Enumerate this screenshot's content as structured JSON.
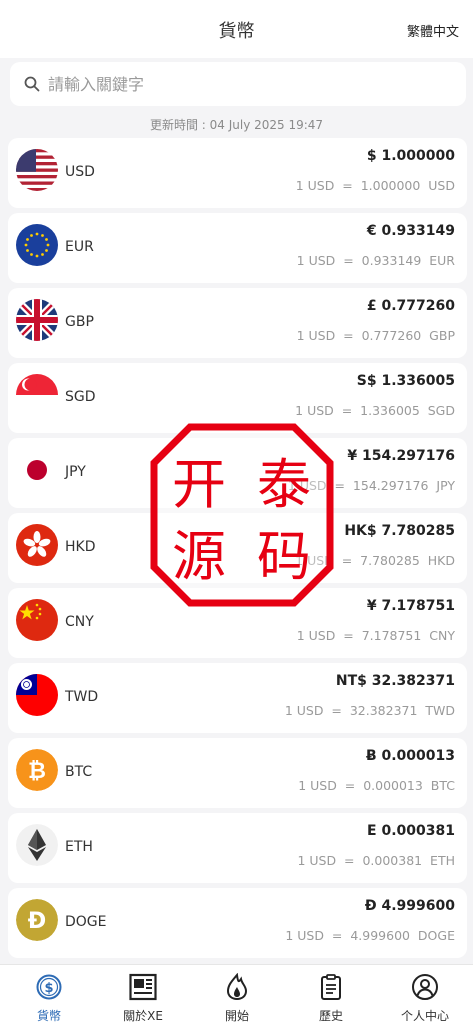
{
  "header": {
    "title": "貨幣",
    "language": "繁體中文"
  },
  "search": {
    "placeholder": "請輸入關鍵字"
  },
  "updated": "更新時間 : 04 July 2025 19:47",
  "currencies": [
    {
      "code": "USD",
      "value": "$ 1.000000",
      "rate": "1 USD  =  1.000000  USD",
      "icon": "us-flag-icon"
    },
    {
      "code": "EUR",
      "value": "€ 0.933149",
      "rate": "1 USD  =  0.933149  EUR",
      "icon": "eu-flag-icon"
    },
    {
      "code": "GBP",
      "value": "£ 0.777260",
      "rate": "1 USD  =  0.777260  GBP",
      "icon": "uk-flag-icon"
    },
    {
      "code": "SGD",
      "value": "S$ 1.336005",
      "rate": "1 USD  =  1.336005  SGD",
      "icon": "sg-flag-icon"
    },
    {
      "code": "JPY",
      "value": "¥ 154.297176",
      "rate": "1 USD  =  154.297176  JPY",
      "icon": "jp-flag-icon"
    },
    {
      "code": "HKD",
      "value": "HK$ 7.780285",
      "rate": "1 USD  =  7.780285  HKD",
      "icon": "hk-flag-icon"
    },
    {
      "code": "CNY",
      "value": "¥ 7.178751",
      "rate": "1 USD  =  7.178751  CNY",
      "icon": "cn-flag-icon"
    },
    {
      "code": "TWD",
      "value": "NT$ 32.382371",
      "rate": "1 USD  =  32.382371  TWD",
      "icon": "tw-flag-icon"
    },
    {
      "code": "BTC",
      "value": "Ƀ 0.000013",
      "rate": "1 USD  =  0.000013  BTC",
      "icon": "bitcoin-icon"
    },
    {
      "code": "ETH",
      "value": "Ε 0.000381",
      "rate": "1 USD  =  0.000381  ETH",
      "icon": "ethereum-icon"
    },
    {
      "code": "DOGE",
      "value": "Ð 4.999600",
      "rate": "1 USD  =  4.999600  DOGE",
      "icon": "dogecoin-icon"
    }
  ],
  "tabs": [
    {
      "label": "貨幣",
      "icon": "dollar-circle-icon",
      "active": true
    },
    {
      "label": "關於XE",
      "icon": "newspaper-icon",
      "active": false
    },
    {
      "label": "開始",
      "icon": "flame-icon",
      "active": false
    },
    {
      "label": "歷史",
      "icon": "clipboard-icon",
      "active": false
    },
    {
      "label": "个人中心",
      "icon": "user-circle-icon",
      "active": false
    }
  ],
  "watermark": {
    "text": "开泰源码",
    "color": "#e60012"
  },
  "colors": {
    "accent": "#2d6bb5"
  }
}
